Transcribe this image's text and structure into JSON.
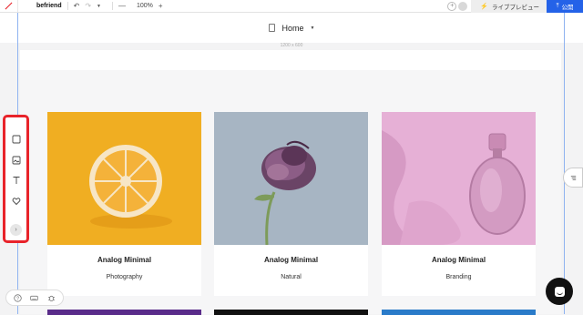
{
  "toolbar": {
    "site_name": "befriend",
    "undo_icon": "undo-icon",
    "redo_icon": "redo-icon",
    "zoom_out": "—",
    "zoom_level": "100%",
    "zoom_in": "+",
    "live_preview_label": "ライブプレビュー",
    "publish_label": "公開"
  },
  "pagebar": {
    "page_name": "Home"
  },
  "canvas": {
    "size_label": "1200 x 600"
  },
  "cards": [
    {
      "title": "Analog Minimal",
      "subtitle": "Photography",
      "image": "orange-on-yellow"
    },
    {
      "title": "Analog Minimal",
      "subtitle": "Natural",
      "image": "purple-rose-on-blue"
    },
    {
      "title": "Analog Minimal",
      "subtitle": "Branding",
      "image": "perfume-bottle-on-pink"
    }
  ],
  "tool_panel": {
    "tools": [
      "square-icon",
      "image-icon",
      "text-icon",
      "heart-icon"
    ],
    "expand_icon": "chevron-right-icon",
    "highlight_color": "#e8232a"
  },
  "colors": {
    "accent": "#2462e8",
    "guide": "#8fb3f0"
  }
}
